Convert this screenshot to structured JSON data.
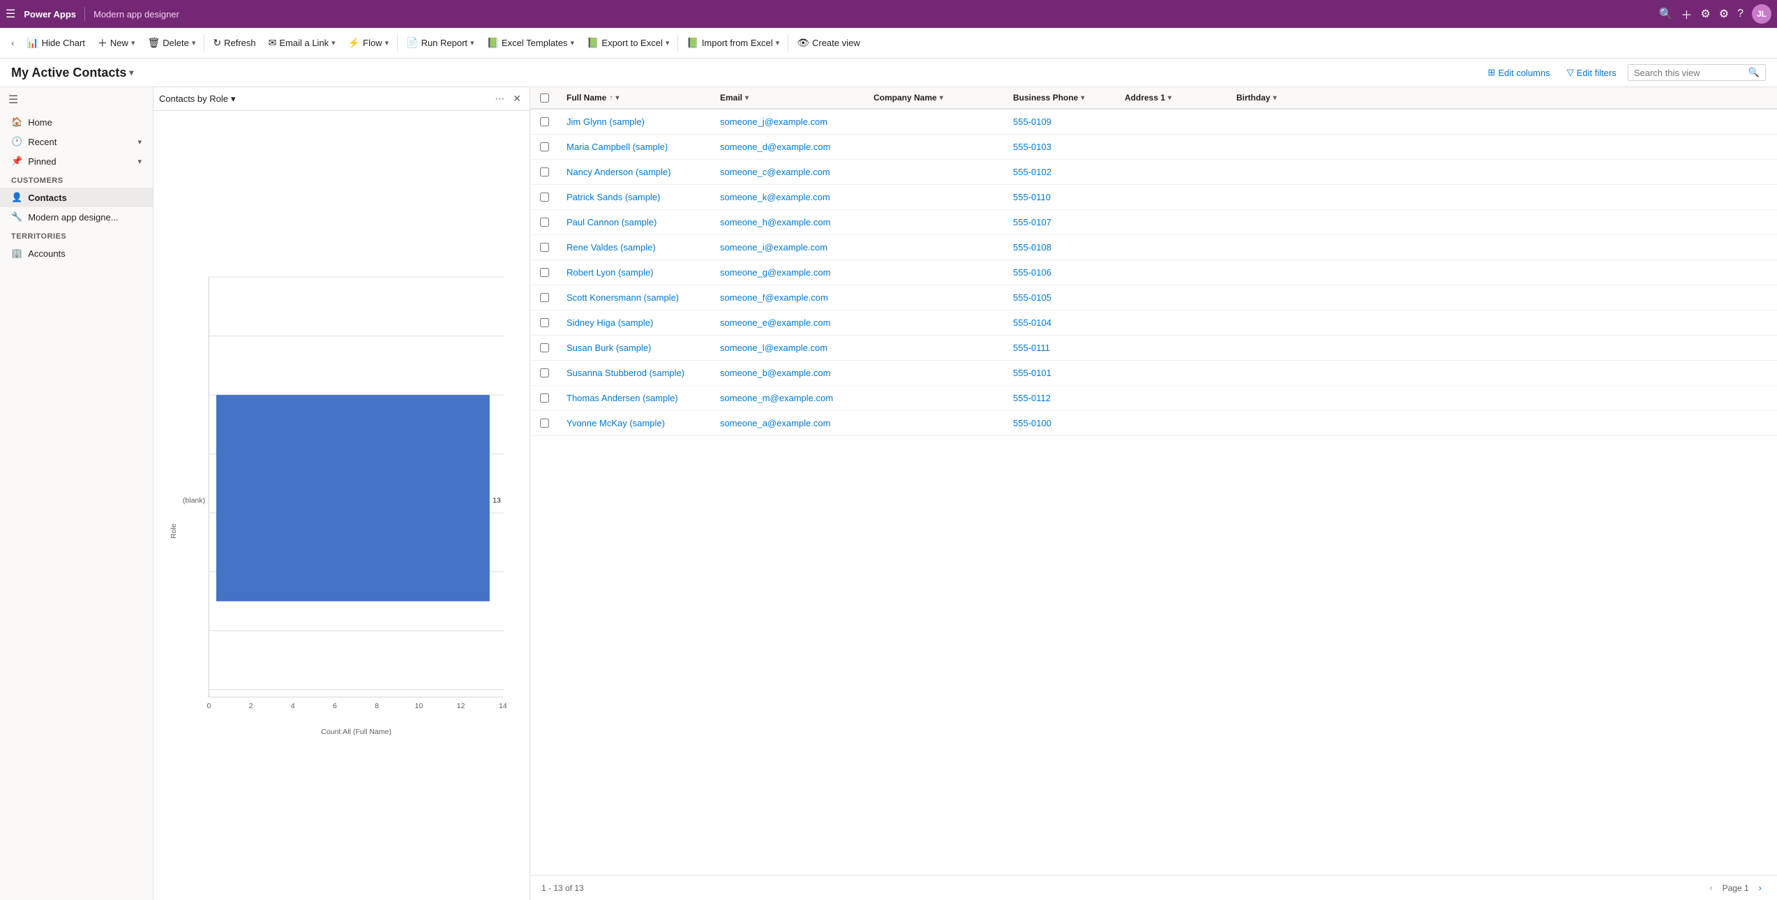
{
  "topbar": {
    "app_name": "Power Apps",
    "page_title": "Modern app designer",
    "avatar_initials": "JL"
  },
  "commandbar": {
    "hide_chart": "Hide Chart",
    "new": "New",
    "delete": "Delete",
    "refresh": "Refresh",
    "email_link": "Email a Link",
    "flow": "Flow",
    "run_report": "Run Report",
    "excel_templates": "Excel Templates",
    "export_excel": "Export to Excel",
    "import_excel": "Import from Excel",
    "create_view": "Create view"
  },
  "view": {
    "title": "My Active Contacts",
    "edit_columns": "Edit columns",
    "edit_filters": "Edit filters",
    "search_placeholder": "Search this view"
  },
  "chart": {
    "title": "Contacts by Role",
    "x_label": "Count:All (Full Name)",
    "y_label": "Role",
    "bar_value": 13,
    "bar_label": "(blank)",
    "x_ticks": [
      "0",
      "2",
      "4",
      "6",
      "8",
      "10",
      "12",
      "14"
    ],
    "bar_color": "#4472C4"
  },
  "sidebar": {
    "nav_items": [
      {
        "label": "Home",
        "icon": "🏠"
      },
      {
        "label": "Recent",
        "icon": "🕐",
        "expandable": true
      },
      {
        "label": "Pinned",
        "icon": "📌",
        "expandable": true
      }
    ],
    "customers_items": [
      {
        "label": "Contacts",
        "icon": "👤",
        "active": true
      },
      {
        "label": "Modern app designe...",
        "icon": "🔧"
      }
    ],
    "territories_items": [
      {
        "label": "Accounts",
        "icon": "🏢"
      }
    ]
  },
  "grid": {
    "columns": [
      {
        "id": "fullname",
        "label": "Full Name",
        "sortable": true,
        "sort": "asc"
      },
      {
        "id": "email",
        "label": "Email",
        "sortable": true
      },
      {
        "id": "company",
        "label": "Company Name",
        "sortable": true
      },
      {
        "id": "phone",
        "label": "Business Phone",
        "sortable": true
      },
      {
        "id": "address",
        "label": "Address 1",
        "sortable": true
      },
      {
        "id": "birthday",
        "label": "Birthday",
        "sortable": true
      }
    ],
    "rows": [
      {
        "fullname": "Jim Glynn (sample)",
        "email": "someone_j@example.com",
        "company": "",
        "phone": "555-0109",
        "address": "",
        "birthday": ""
      },
      {
        "fullname": "Maria Campbell (sample)",
        "email": "someone_d@example.com",
        "company": "",
        "phone": "555-0103",
        "address": "",
        "birthday": ""
      },
      {
        "fullname": "Nancy Anderson (sample)",
        "email": "someone_c@example.com",
        "company": "",
        "phone": "555-0102",
        "address": "",
        "birthday": ""
      },
      {
        "fullname": "Patrick Sands (sample)",
        "email": "someone_k@example.com",
        "company": "",
        "phone": "555-0110",
        "address": "",
        "birthday": ""
      },
      {
        "fullname": "Paul Cannon (sample)",
        "email": "someone_h@example.com",
        "company": "",
        "phone": "555-0107",
        "address": "",
        "birthday": ""
      },
      {
        "fullname": "Rene Valdes (sample)",
        "email": "someone_i@example.com",
        "company": "",
        "phone": "555-0108",
        "address": "",
        "birthday": ""
      },
      {
        "fullname": "Robert Lyon (sample)",
        "email": "someone_g@example.com",
        "company": "",
        "phone": "555-0106",
        "address": "",
        "birthday": ""
      },
      {
        "fullname": "Scott Konersmann (sample)",
        "email": "someone_f@example.com",
        "company": "",
        "phone": "555-0105",
        "address": "",
        "birthday": ""
      },
      {
        "fullname": "Sidney Higa (sample)",
        "email": "someone_e@example.com",
        "company": "",
        "phone": "555-0104",
        "address": "",
        "birthday": ""
      },
      {
        "fullname": "Susan Burk (sample)",
        "email": "someone_l@example.com",
        "company": "",
        "phone": "555-0111",
        "address": "",
        "birthday": ""
      },
      {
        "fullname": "Susanna Stubberod (sample)",
        "email": "someone_b@example.com",
        "company": "",
        "phone": "555-0101",
        "address": "",
        "birthday": ""
      },
      {
        "fullname": "Thomas Andersen (sample)",
        "email": "someone_m@example.com",
        "company": "",
        "phone": "555-0112",
        "address": "",
        "birthday": ""
      },
      {
        "fullname": "Yvonne McKay (sample)",
        "email": "someone_a@example.com",
        "company": "",
        "phone": "555-0100",
        "address": "",
        "birthday": ""
      }
    ],
    "footer": {
      "record_count": "1 - 13 of 13",
      "page_label": "Page 1"
    }
  }
}
